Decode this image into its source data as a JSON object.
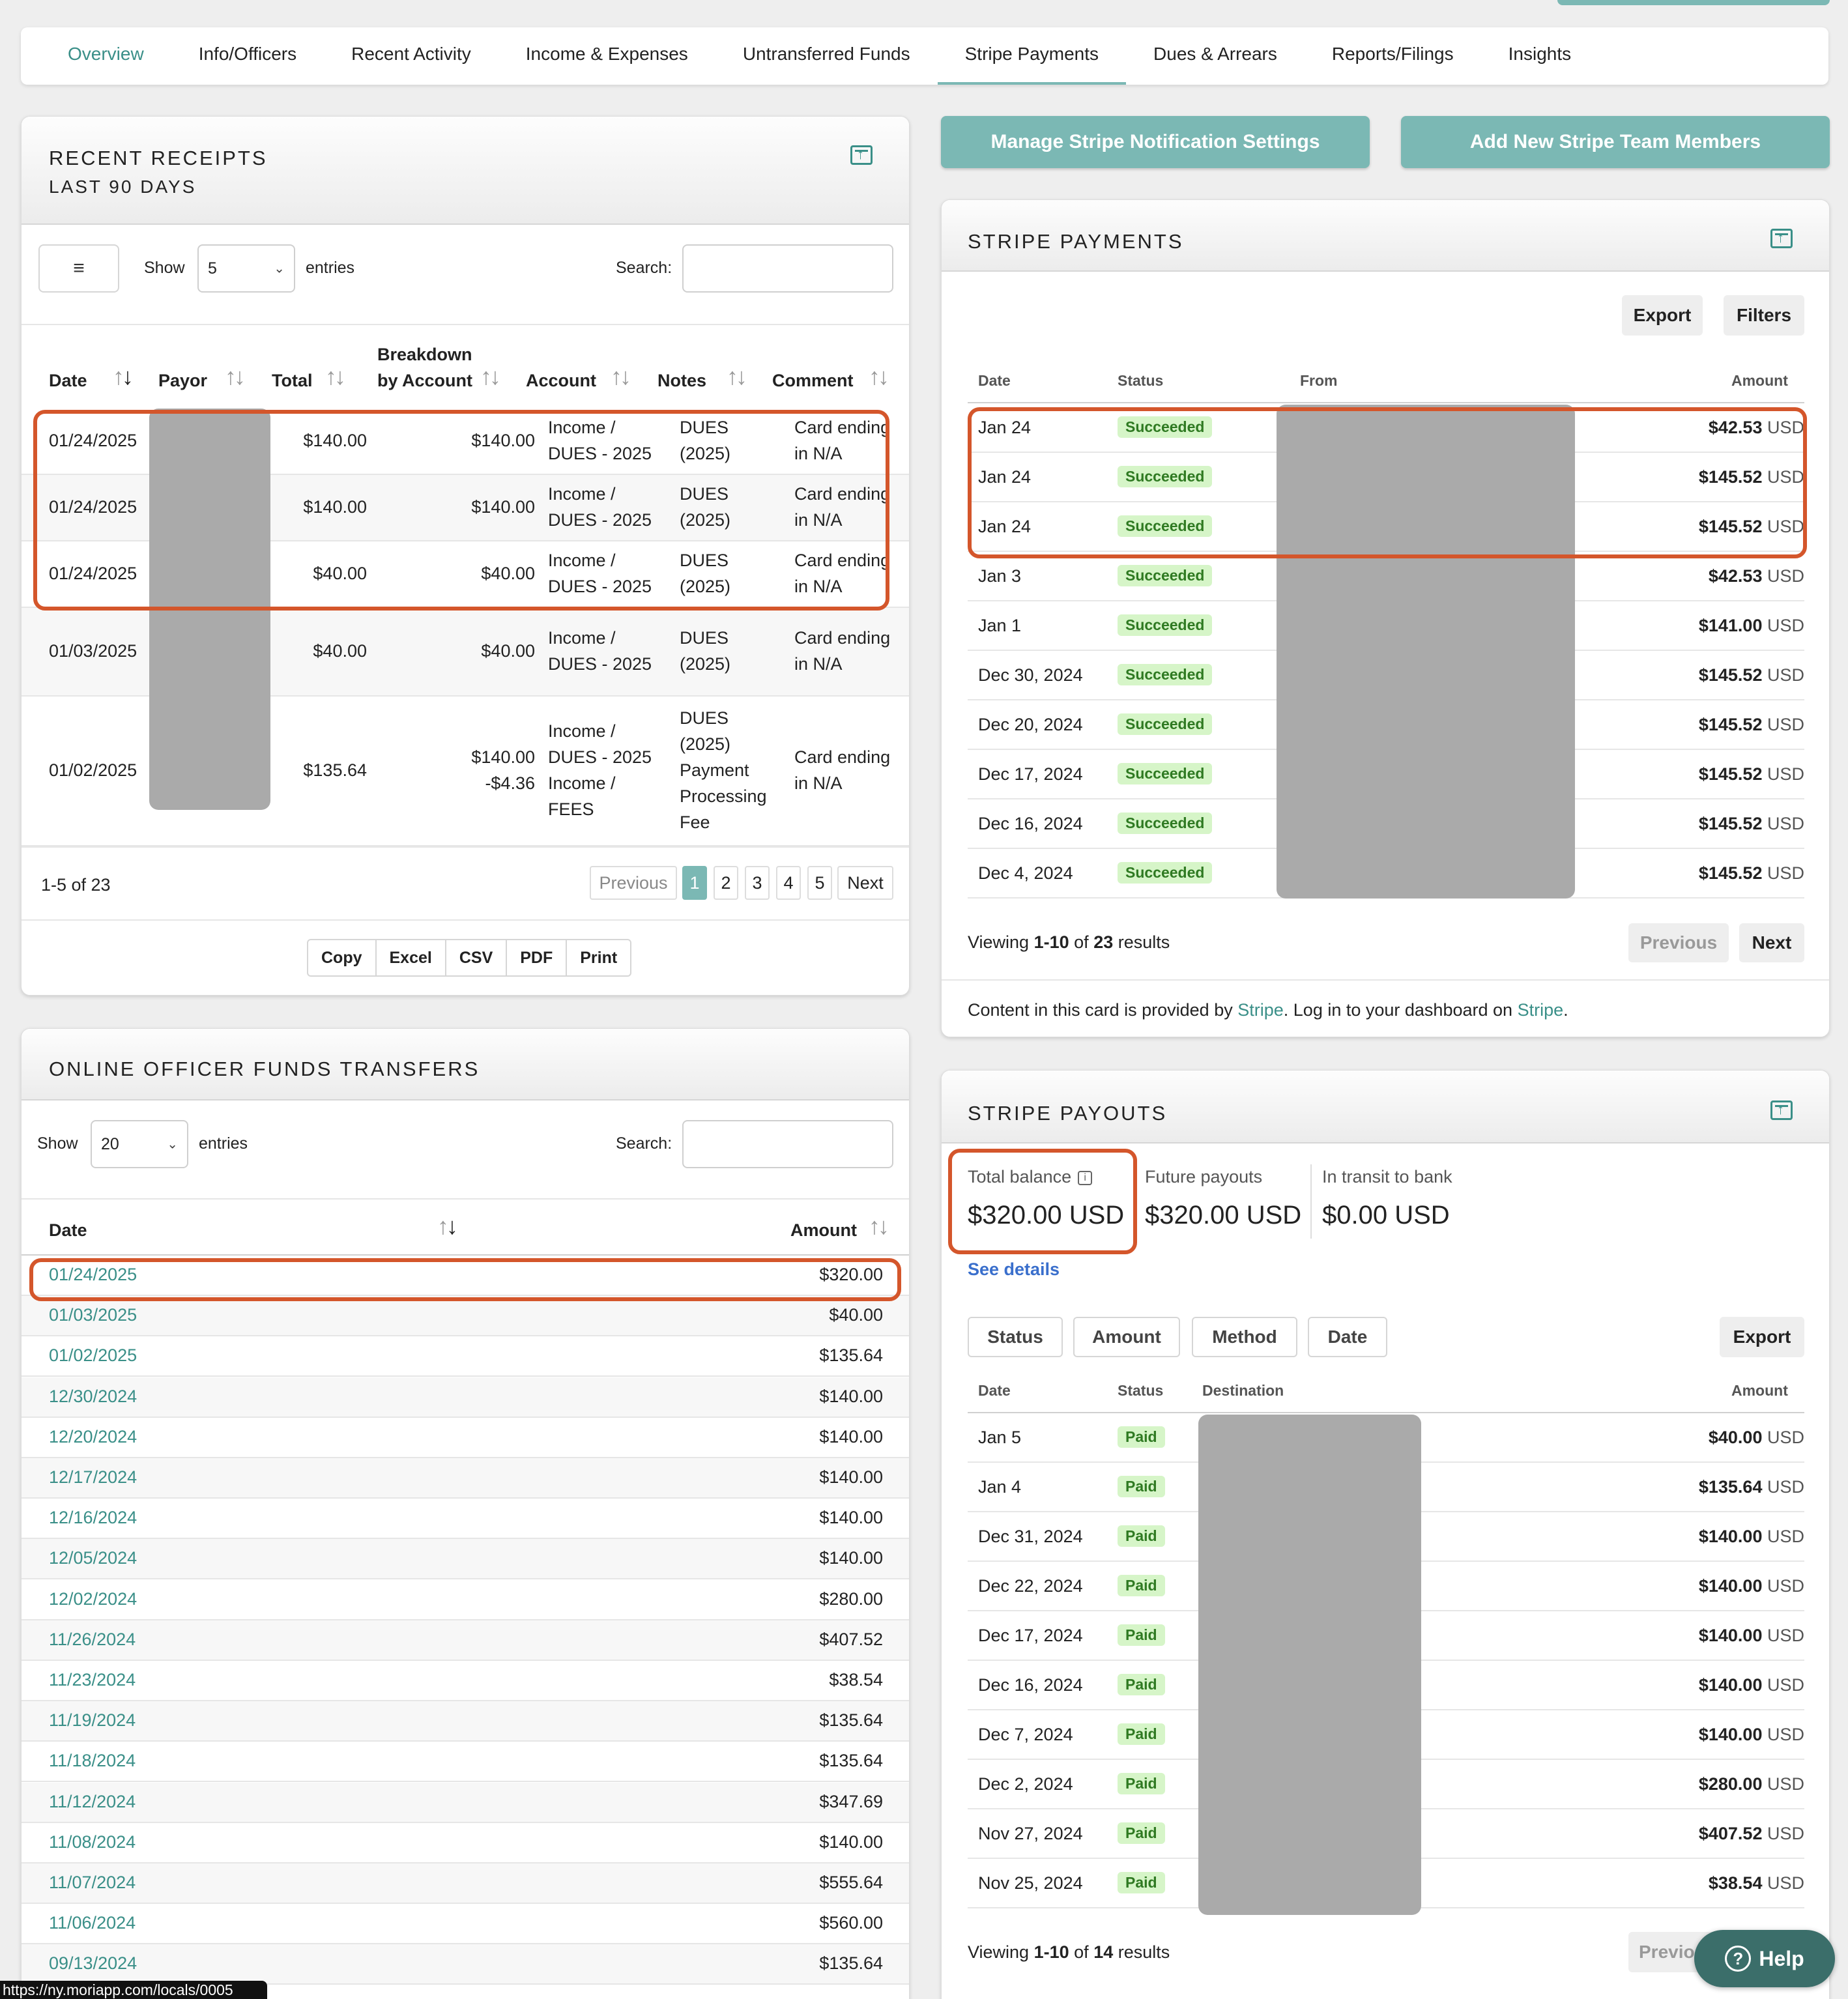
{
  "tabs": [
    "Overview",
    "Info/Officers",
    "Recent Activity",
    "Income & Expenses",
    "Untransferred Funds",
    "Stripe Payments",
    "Dues & Arrears",
    "Reports/Filings",
    "Insights"
  ],
  "receipts": {
    "title": "RECENT RECEIPTS",
    "subtitle": "LAST 90 DAYS",
    "menu_icon": "≡",
    "show_label": "Show",
    "show_value": "5",
    "entries_label": "entries",
    "search_label": "Search:",
    "headers": {
      "date": "Date",
      "payor": "Payor",
      "total": "Total",
      "breakdown_1": "Breakdown",
      "breakdown_2": "by Account",
      "account": "Account",
      "notes": "Notes",
      "comment": "Comment"
    },
    "rows": [
      {
        "date": "01/24/2025",
        "total": "$140.00",
        "breakdown": [
          "$140.00"
        ],
        "account": [
          "Income /",
          "DUES - 2025"
        ],
        "notes": [
          "DUES",
          "(2025)"
        ],
        "comment": [
          "Card ending",
          "in N/A"
        ]
      },
      {
        "date": "01/24/2025",
        "total": "$140.00",
        "breakdown": [
          "$140.00"
        ],
        "account": [
          "Income /",
          "DUES - 2025"
        ],
        "notes": [
          "DUES",
          "(2025)"
        ],
        "comment": [
          "Card ending",
          "in N/A"
        ]
      },
      {
        "date": "01/24/2025",
        "total": "$40.00",
        "breakdown": [
          "$40.00"
        ],
        "account": [
          "Income /",
          "DUES - 2025"
        ],
        "notes": [
          "DUES",
          "(2025)"
        ],
        "comment": [
          "Card ending",
          "in N/A"
        ]
      },
      {
        "date": "01/03/2025",
        "total": "$40.00",
        "breakdown": [
          "$40.00"
        ],
        "account": [
          "Income /",
          "DUES - 2025"
        ],
        "notes": [
          "DUES",
          "(2025)"
        ],
        "comment": [
          "Card ending",
          "in N/A"
        ]
      },
      {
        "date": "01/02/2025",
        "total": "$135.64",
        "breakdown": [
          "$140.00",
          "-$4.36"
        ],
        "account": [
          "Income /",
          "DUES - 2025",
          "Income /",
          "FEES"
        ],
        "notes": [
          "DUES",
          "(2025)",
          "Payment",
          "Processing",
          "Fee"
        ],
        "comment": [
          "Card ending",
          "in N/A"
        ]
      }
    ],
    "summary": "1-5 of 23",
    "pager": {
      "previous": "Previous",
      "pages": [
        "1",
        "2",
        "3",
        "4",
        "5"
      ],
      "next": "Next"
    },
    "export_buttons": [
      "Copy",
      "Excel",
      "CSV",
      "PDF",
      "Print"
    ]
  },
  "transfers": {
    "title": "ONLINE OFFICER FUNDS TRANSFERS",
    "show_label": "Show",
    "show_value": "20",
    "entries_label": "entries",
    "search_label": "Search:",
    "headers": {
      "date": "Date",
      "amount": "Amount"
    },
    "rows": [
      {
        "date": "01/24/2025",
        "amount": "$320.00"
      },
      {
        "date": "01/03/2025",
        "amount": "$40.00"
      },
      {
        "date": "01/02/2025",
        "amount": "$135.64"
      },
      {
        "date": "12/30/2024",
        "amount": "$140.00"
      },
      {
        "date": "12/20/2024",
        "amount": "$140.00"
      },
      {
        "date": "12/17/2024",
        "amount": "$140.00"
      },
      {
        "date": "12/16/2024",
        "amount": "$140.00"
      },
      {
        "date": "12/05/2024",
        "amount": "$140.00"
      },
      {
        "date": "12/02/2024",
        "amount": "$280.00"
      },
      {
        "date": "11/26/2024",
        "amount": "$407.52"
      },
      {
        "date": "11/23/2024",
        "amount": "$38.54"
      },
      {
        "date": "11/19/2024",
        "amount": "$135.64"
      },
      {
        "date": "11/18/2024",
        "amount": "$135.64"
      },
      {
        "date": "11/12/2024",
        "amount": "$347.69"
      },
      {
        "date": "11/08/2024",
        "amount": "$140.00"
      },
      {
        "date": "11/07/2024",
        "amount": "$555.64"
      },
      {
        "date": "11/06/2024",
        "amount": "$560.00"
      },
      {
        "date": "09/13/2024",
        "amount": "$135.64"
      }
    ]
  },
  "buttons": {
    "manage_notifications": "Manage Stripe Notification Settings",
    "add_team_members": "Add New Stripe Team Members"
  },
  "stripe_payments": {
    "title": "STRIPE PAYMENTS",
    "export": "Export",
    "filters": "Filters",
    "headers": {
      "date": "Date",
      "status": "Status",
      "from": "From",
      "amount": "Amount"
    },
    "currency": "USD",
    "rows": [
      {
        "date": "Jan 24",
        "status": "Succeeded",
        "amount": "$42.53"
      },
      {
        "date": "Jan 24",
        "status": "Succeeded",
        "amount": "$145.52"
      },
      {
        "date": "Jan 24",
        "status": "Succeeded",
        "amount": "$145.52"
      },
      {
        "date": "Jan 3",
        "status": "Succeeded",
        "amount": "$42.53"
      },
      {
        "date": "Jan 1",
        "status": "Succeeded",
        "amount": "$141.00"
      },
      {
        "date": "Dec 30, 2024",
        "status": "Succeeded",
        "amount": "$145.52"
      },
      {
        "date": "Dec 20, 2024",
        "status": "Succeeded",
        "amount": "$145.52"
      },
      {
        "date": "Dec 17, 2024",
        "status": "Succeeded",
        "amount": "$145.52"
      },
      {
        "date": "Dec 16, 2024",
        "status": "Succeeded",
        "amount": "$145.52"
      },
      {
        "date": "Dec 4, 2024",
        "status": "Succeeded",
        "amount": "$145.52"
      }
    ],
    "viewing_prefix": "Viewing",
    "viewing_range": "1-10",
    "viewing_of": "of",
    "viewing_total": "23",
    "viewing_suffix": "results",
    "previous": "Previous",
    "next": "Next",
    "footer_1": "Content in this card is provided by",
    "footer_link_1": "Stripe",
    "footer_2": ". Log in to your dashboard on",
    "footer_link_2": "Stripe",
    "footer_3": "."
  },
  "stripe_payouts": {
    "title": "STRIPE PAYOUTS",
    "total_balance_label": "Total balance",
    "total_balance_value": "$320.00 USD",
    "future_payouts_label": "Future payouts",
    "future_payouts_value": "$320.00 USD",
    "in_transit_label": "In transit to bank",
    "in_transit_value": "$0.00 USD",
    "see_details": "See details",
    "filters": [
      "Status",
      "Amount",
      "Method",
      "Date"
    ],
    "export": "Export",
    "headers": {
      "date": "Date",
      "status": "Status",
      "destination": "Destination",
      "amount": "Amount"
    },
    "currency": "USD",
    "rows": [
      {
        "date": "Jan 5",
        "status": "Paid",
        "amount": "$40.00"
      },
      {
        "date": "Jan 4",
        "status": "Paid",
        "amount": "$135.64"
      },
      {
        "date": "Dec 31, 2024",
        "status": "Paid",
        "amount": "$140.00"
      },
      {
        "date": "Dec 22, 2024",
        "status": "Paid",
        "amount": "$140.00"
      },
      {
        "date": "Dec 17, 2024",
        "status": "Paid",
        "amount": "$140.00"
      },
      {
        "date": "Dec 16, 2024",
        "status": "Paid",
        "amount": "$140.00"
      },
      {
        "date": "Dec 7, 2024",
        "status": "Paid",
        "amount": "$140.00"
      },
      {
        "date": "Dec 2, 2024",
        "status": "Paid",
        "amount": "$280.00"
      },
      {
        "date": "Nov 27, 2024",
        "status": "Paid",
        "amount": "$407.52"
      },
      {
        "date": "Nov 25, 2024",
        "status": "Paid",
        "amount": "$38.54"
      }
    ],
    "viewing_prefix": "Viewing",
    "viewing_range": "1-10",
    "viewing_of": "of",
    "viewing_total": "14",
    "viewing_suffix": "results",
    "previous": "Previo"
  },
  "help": {
    "label": "Help",
    "icon": "?"
  },
  "status_url": "https://ny.moriapp.com/locals/0005",
  "colors": {
    "accent": "#7bb8b4",
    "link": "#3a8f88",
    "highlight": "#d4562b",
    "success_bg": "#d6f5c8",
    "success_text": "#2f7a22"
  }
}
